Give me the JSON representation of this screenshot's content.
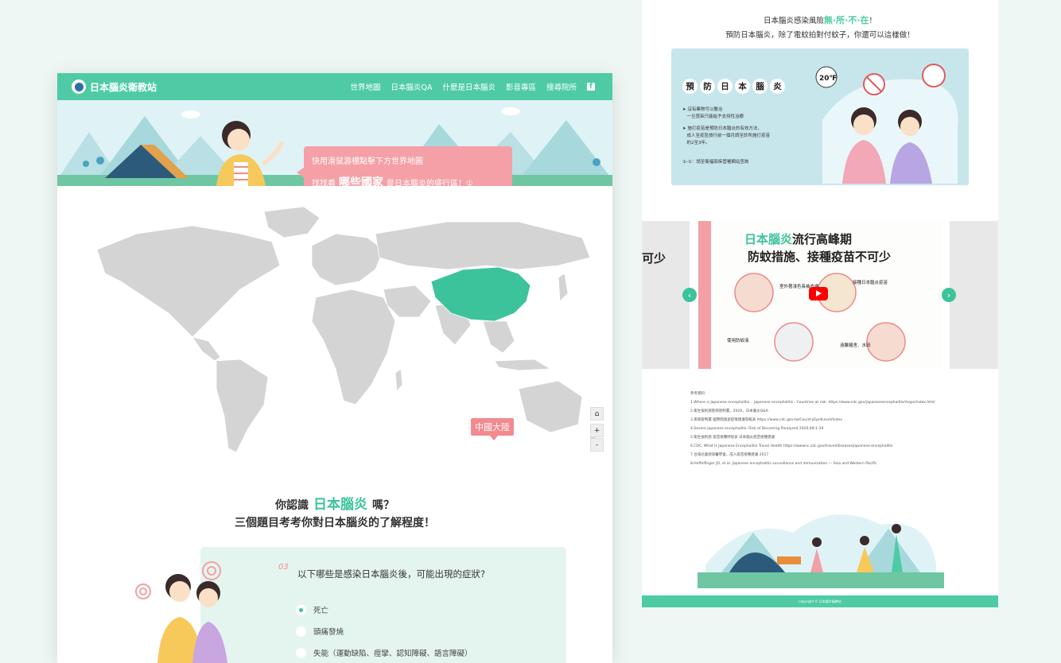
{
  "site": {
    "logo_text": "日本腦炎衛教站",
    "nav": [
      "世界地圖",
      "日本腦炎QA",
      "什麼是日本腦炎",
      "影音專區",
      "搜尋院所"
    ],
    "facebook_icon": "f"
  },
  "hero": {
    "line1": "快用滑鼠游標點擊下方世界地圖",
    "line2_pre": "找找看",
    "line2_highlight": "哪些國家",
    "line2_post": "是日本腦炎的盛行區！①"
  },
  "map": {
    "highlight_label": "中國大陸",
    "controls": {
      "home": "⌂",
      "zoom_in": "+",
      "zoom_out": "-"
    }
  },
  "quiz": {
    "title_pre": "你認識",
    "title_highlight": "日本腦炎",
    "title_post": "嗎？",
    "subtitle": "三個題目考考你對日本腦炎的了解程度！",
    "question_number": "03",
    "question": "以下哪些是感染日本腦炎後，可能出現的症狀?",
    "options": [
      {
        "label": "死亡",
        "selected": true
      },
      {
        "label": "頭痛發燒",
        "selected": false
      },
      {
        "label": "失能（運動缺陷、痙攣、認知障礙、語言障礙）",
        "selected": false
      }
    ]
  },
  "right": {
    "header1_pre": "日本腦炎感染風險",
    "header1_highlight": "無·所·不·在",
    "header1_post": "！",
    "header2": "預防日本腦炎，除了電蚊拍對付蚊子，你還可以這樣做！",
    "prevent_title": [
      "預",
      "防",
      "日",
      "本",
      "腦",
      "炎"
    ],
    "temp_badge": "20℉",
    "prevent_lines": [
      "➤ 沒有藥物可以醫治",
      "　一旦感染只能給予支持性治療",
      "➤ 施打疫苗是預防日本腦炎的有效方法，",
      "　成人至疫區旅行前一個月請至診所施打疫苗",
      "　約2至3年。",
      "①-①：請至衛福部疾管署網站查詢"
    ],
    "slide_title_green": "日本腦炎",
    "slide_title_rest": "流行高峰期",
    "slide_subtitle": "防蚊措施、接種疫苗不可少",
    "slide_captions": [
      "室外著淺色長袖衣褲",
      "接種日本腦炎疫苗",
      "使用防蚊液",
      "遠離豬舍、水田"
    ],
    "side_left_text": "可少",
    "refs": [
      "參考資料：",
      "1.Where is Japanese encephalitis... Japanese encephalitis - Countries at risk. https://www.cdc.gov/japaneseencephalitis/maps/index.html",
      "2.衛生福利部疾病管制署，2020，日本腦炎Q&A",
      "3.疾病管制署 國際間旅遊疫情建議等級表 https://www.cdc.gov.tw/CountryEpidLevel/Index",
      "4.Severe Japanese encephalitis: Risk of Becoming Paralyzed 2020;48:1-19",
      "5.衛生福利部 疫苗接種時程表 日本腦炎疫苗接種建議",
      "6.CDC, What Is Japanese Encephalitis Travel Health https://wwwnc.cdc.gov/travel/diseases/japanese-encephalitis",
      "7.台灣兒童感染醫學會，成人疫苗接種建議 2017",
      "8.Heffelfinger JD, et al. Japanese encephalitis surveillance and immunization — Asia and Western Pacific"
    ],
    "footer": "copyright © 日本腦炎衛教站"
  },
  "colors": {
    "brand": "#4ecba5",
    "accent_pink": "#f4a0a6",
    "map_land": "#d4d4d4",
    "map_highlight": "#3cc39b"
  }
}
